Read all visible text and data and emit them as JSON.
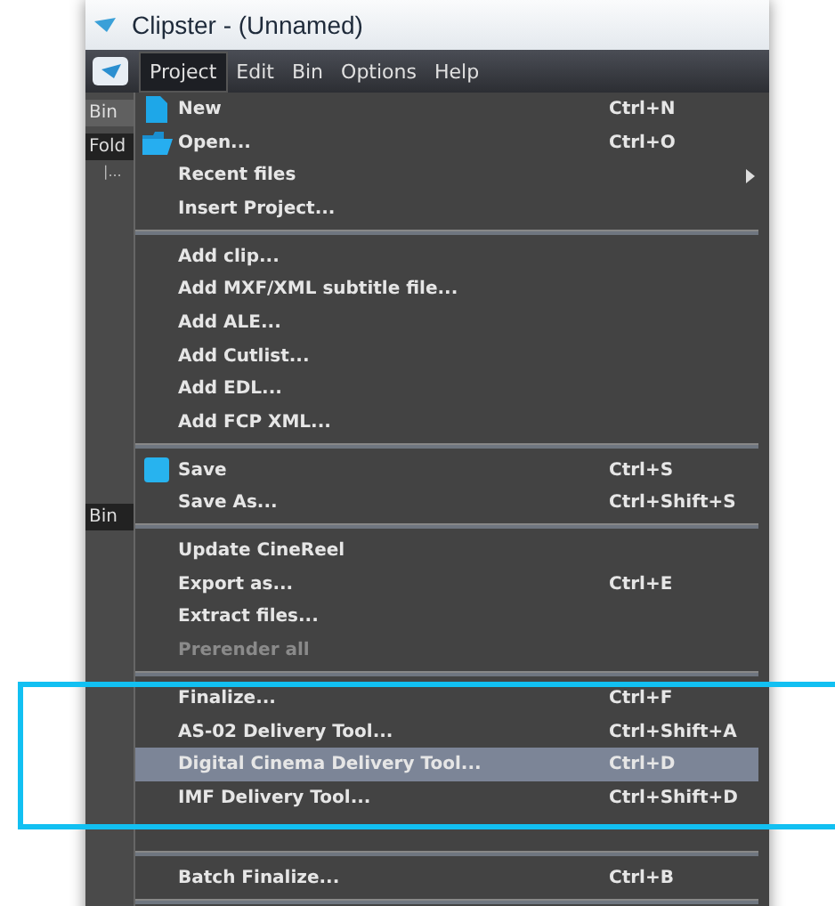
{
  "window": {
    "title": "Clipster - (Unnamed)"
  },
  "menubar": [
    {
      "label": "Project",
      "selected": true
    },
    {
      "label": "Edit",
      "selected": false
    },
    {
      "label": "Bin",
      "selected": false
    },
    {
      "label": "Options",
      "selected": false
    },
    {
      "label": "Help",
      "selected": false
    }
  ],
  "side_panel": {
    "tabs": [
      {
        "label": "Bin",
        "selected": true
      },
      {
        "label": "Fold",
        "selected": false
      }
    ],
    "tree_item": "|...",
    "bottom_tab": "Bin"
  },
  "menu": [
    {
      "kind": "item",
      "label": "New",
      "shortcut": "Ctrl+N",
      "selected": false,
      "disabled": false
    },
    {
      "kind": "item",
      "label": "Open...",
      "shortcut": "Ctrl+O",
      "selected": false,
      "disabled": false
    },
    {
      "kind": "submenu",
      "label": "Recent files",
      "selected": false,
      "disabled": false
    },
    {
      "kind": "item",
      "label": "Insert Project...",
      "selected": false,
      "disabled": false
    },
    {
      "kind": "separator"
    },
    {
      "kind": "item",
      "label": "Add clip...",
      "selected": false,
      "disabled": false
    },
    {
      "kind": "item",
      "label": "Add MXF/XML subtitle file...",
      "selected": false,
      "disabled": false
    },
    {
      "kind": "item",
      "label": "Add ALE...",
      "selected": false,
      "disabled": false
    },
    {
      "kind": "item",
      "label": "Add Cutlist...",
      "selected": false,
      "disabled": false
    },
    {
      "kind": "item",
      "label": "Add EDL...",
      "selected": false,
      "disabled": false
    },
    {
      "kind": "item",
      "label": "Add FCP XML...",
      "selected": false,
      "disabled": false
    },
    {
      "kind": "separator"
    },
    {
      "kind": "item",
      "label": "Save",
      "shortcut": "Ctrl+S",
      "selected": false,
      "disabled": false
    },
    {
      "kind": "item",
      "label": "Save As...",
      "shortcut": "Ctrl+Shift+S",
      "selected": false,
      "disabled": false
    },
    {
      "kind": "separator"
    },
    {
      "kind": "item",
      "label": "Update CineReel",
      "selected": false,
      "disabled": false
    },
    {
      "kind": "item",
      "label": "Export as...",
      "shortcut": "Ctrl+E",
      "selected": false,
      "disabled": false
    },
    {
      "kind": "item",
      "label": "Extract files...",
      "selected": false,
      "disabled": false
    },
    {
      "kind": "item",
      "label": "Prerender all",
      "selected": false,
      "disabled": true
    },
    {
      "kind": "separator"
    },
    {
      "kind": "item",
      "label": "Finalize...",
      "shortcut": "Ctrl+F",
      "selected": false,
      "disabled": false
    },
    {
      "kind": "item",
      "label": "AS-02 Delivery Tool...",
      "shortcut": "Ctrl+Shift+A",
      "selected": false,
      "disabled": false
    },
    {
      "kind": "item",
      "label": "Digital Cinema Delivery Tool...",
      "shortcut": "Ctrl+D",
      "selected": true,
      "disabled": false
    },
    {
      "kind": "item",
      "label": "IMF Delivery Tool...",
      "shortcut": "Ctrl+Shift+D",
      "selected": false,
      "disabled": false
    },
    {
      "kind": "blank"
    },
    {
      "kind": "separator"
    },
    {
      "kind": "item",
      "label": "Batch Finalize...",
      "shortcut": "Ctrl+B",
      "selected": false,
      "disabled": false
    },
    {
      "kind": "separator"
    }
  ]
}
